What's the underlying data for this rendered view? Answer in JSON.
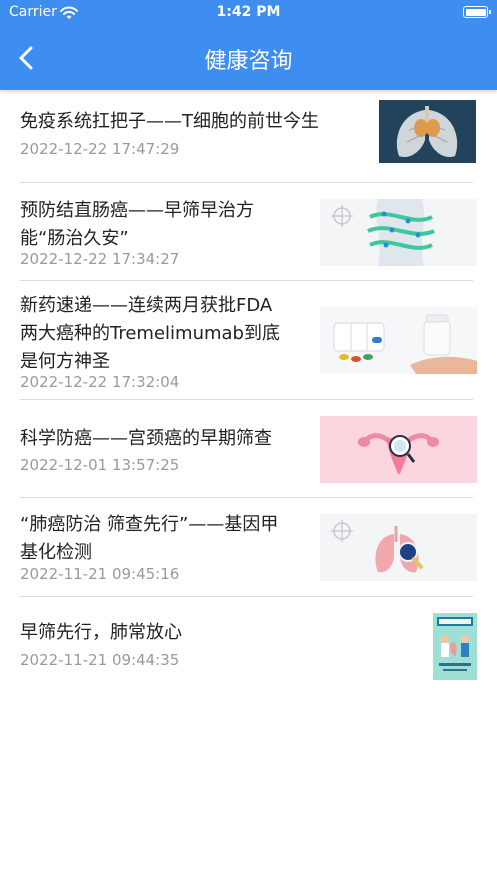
{
  "status_bar": {
    "carrier": "Carrier",
    "time": "1:42 PM"
  },
  "nav": {
    "title": "健康咨询",
    "back_icon": "chevron-left-icon"
  },
  "colors": {
    "brand": "#3d8ef0",
    "title_text": "#222222",
    "date_text": "#9a9a9a",
    "divider": "#dcdcdc"
  },
  "articles": [
    {
      "title_lines": [
        "免疫系统扛把子——T细胞的前世今生"
      ],
      "date": "2022-12-22 17:47:29",
      "thumbnail": "lungs-image"
    },
    {
      "title_lines": [
        "预防结直肠癌——早筛早治方",
        "能“肠治久安”"
      ],
      "date": "2022-12-22 17:34:27",
      "thumbnail": "intestine-illustration"
    },
    {
      "title_lines": [
        "新药速递——连续两月获批FDA",
        "两大癌种的Tremelimumab到底",
        "是何方神圣"
      ],
      "date": "2022-12-22 17:32:04",
      "thumbnail": "pills-bottle-image"
    },
    {
      "title_lines": [
        "科学防癌——宫颈癌的早期筛查"
      ],
      "date": "2022-12-01 13:57:25",
      "thumbnail": "uterus-illustration"
    },
    {
      "title_lines": [
        "“肺癌防治 筛查先行”——基因甲",
        "基化检测"
      ],
      "date": "2022-11-21 09:45:16",
      "thumbnail": "lung-magnifier-illustration"
    },
    {
      "title_lines": [
        "早筛先行，肺常放心"
      ],
      "date": "2022-11-21 09:44:35",
      "thumbnail": "poster-image"
    }
  ]
}
